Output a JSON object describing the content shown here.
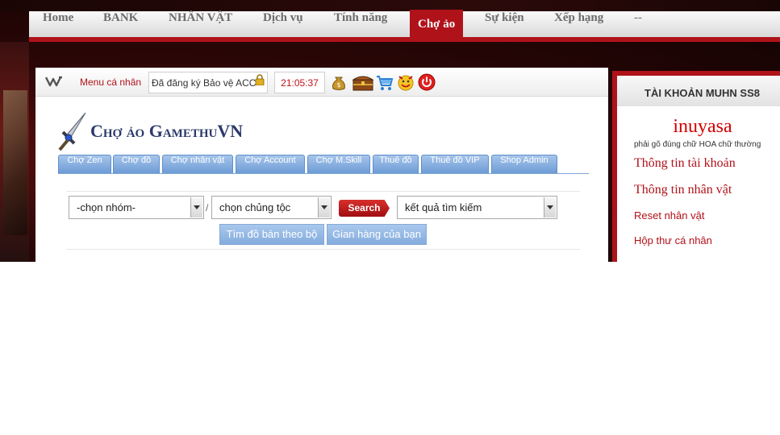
{
  "nav": {
    "items": [
      {
        "label": "Home"
      },
      {
        "label": "BANK"
      },
      {
        "label": "NHÂN VẬT"
      },
      {
        "label": "Dịch vụ"
      },
      {
        "label": "Tính năng"
      },
      {
        "label": "Chợ ảo"
      },
      {
        "label": "Sự kiện"
      },
      {
        "label": "Xếp hạng"
      },
      {
        "label": "--"
      }
    ],
    "active_index": 5
  },
  "toolbar": {
    "menu_label": "Menu cá nhân",
    "status_text": "Đã đăng ký Bảo vệ ACC",
    "clock": "21:05:37",
    "icons": [
      "money-bag-icon",
      "treasure-chest-icon",
      "shopping-cart-icon",
      "smiley-icon",
      "power-icon"
    ]
  },
  "content": {
    "title": "Chợ ảo GamethuVN",
    "tabs": [
      {
        "label": "Chợ Zen"
      },
      {
        "label": "Chợ đồ"
      },
      {
        "label": "Chợ nhân vật"
      },
      {
        "label": "Chợ Account"
      },
      {
        "label": "Chợ M.Skill"
      },
      {
        "label": "Thuê đồ"
      },
      {
        "label": "Thuê đồ VIP"
      },
      {
        "label": "Shop Admin"
      }
    ],
    "search": {
      "group_select": "-chọn nhóm-",
      "race_select": "chọn chủng tộc",
      "search_button": "Search",
      "result_select": "kết quả tìm kiếm",
      "slash": "/"
    },
    "actions": {
      "find_set": "Tìm đồ bán theo bộ",
      "my_shop": "Gian hàng của bạn"
    }
  },
  "account": {
    "header": "TÀI KHOẢN MUHN SS8",
    "username": "inuyasa",
    "username_note": "phải gõ đúng chữ HOA chữ thường",
    "links": [
      {
        "label": "Thông tin tài khoản"
      },
      {
        "label": "Thông tin nhân vật"
      },
      {
        "label": "Reset nhân vật"
      },
      {
        "label": "Hộp thư cá nhân"
      }
    ]
  },
  "colors": {
    "brand_red": "#b0121a",
    "tab_blue": "#84acde",
    "title_navy": "#2a3a6a"
  }
}
